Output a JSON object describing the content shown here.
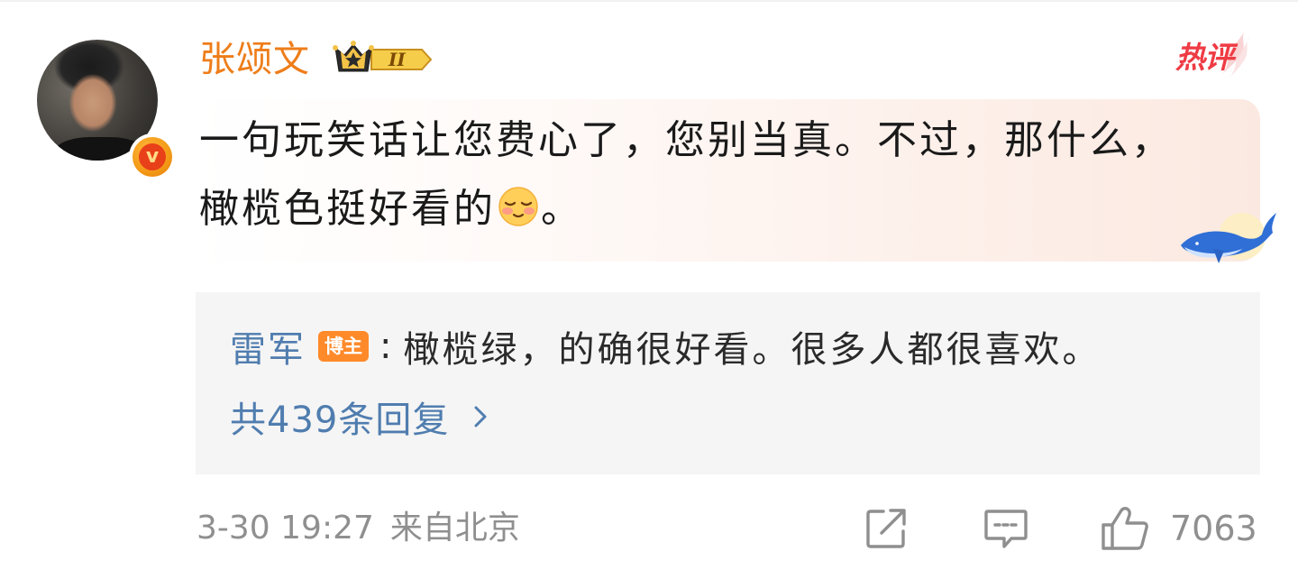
{
  "comment": {
    "author": {
      "name": "张颂文",
      "level": "II",
      "verified": true
    },
    "hot_label": "热评",
    "content_part1": "一句玩笑话让您费心了，您别当真。不过，那什么，橄榄色挺好看的",
    "emoji": "blush-emoji",
    "content_part2": "。",
    "reply_preview": {
      "user": "雷军",
      "badge": "博主",
      "separator": ":",
      "text": "橄榄绿，的确很好看。很多人都很喜欢。"
    },
    "reply_count_label": "共439条回复",
    "timestamp": "3-30 19:27",
    "location": "来自北京",
    "like_count": "7063"
  },
  "colors": {
    "username": "#ee7d19",
    "link_blue": "#507daf",
    "hot_red": "#ef3b44",
    "badge_orange": "#ff8a2a",
    "meta_gray": "#8f8f8f"
  },
  "icons": {
    "repost": "repost-icon",
    "comment": "comment-icon",
    "like": "thumbs-up-icon",
    "chevron": "chevron-right-icon",
    "decoration": "whale-icon",
    "level": "crown-level-icon"
  }
}
